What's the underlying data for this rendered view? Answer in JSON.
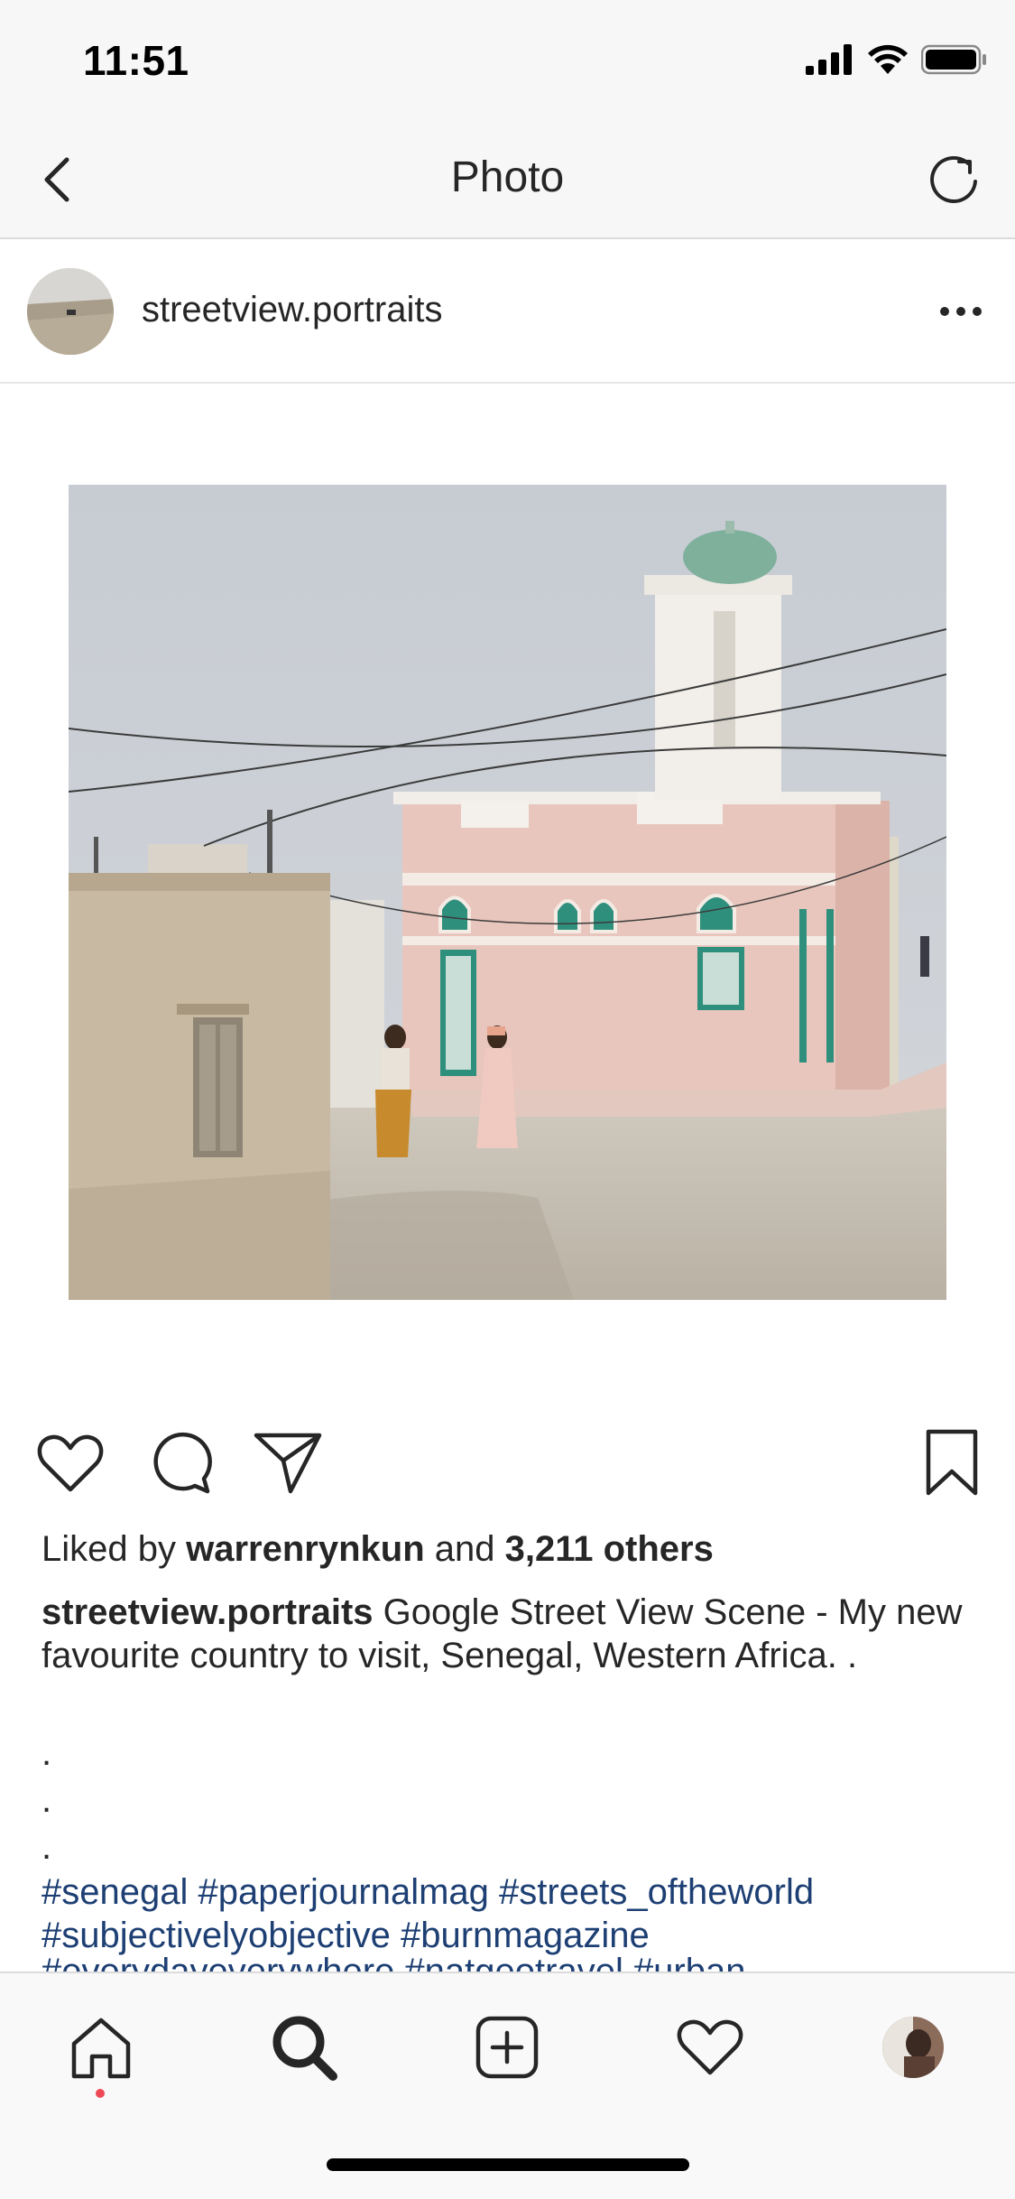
{
  "status_bar": {
    "time": "11:51"
  },
  "nav": {
    "title": "Photo",
    "back_icon": "chevron-left-icon",
    "refresh_icon": "refresh-icon"
  },
  "post": {
    "username": "streetview.portraits",
    "more_icon": "more-horizontal-icon",
    "image_description_icon": "mosque-street-photo"
  },
  "actions": {
    "like_icon": "heart-icon",
    "comment_icon": "comment-icon",
    "share_icon": "send-icon",
    "save_icon": "bookmark-icon"
  },
  "likes": {
    "prefix": "Liked by ",
    "user": "warrenrynkun",
    "middle": " and ",
    "count": "3,211 others"
  },
  "caption": {
    "username": "streetview.portraits",
    "text": " Google Street View Scene - My new favourite country to visit, Senegal, Western Africa. .",
    "dots": [
      ".",
      ".",
      "."
    ]
  },
  "hashtags": {
    "line1": "#senegal #paperjournalmag  #streets_oftheworld",
    "line2": "#subjectivelyobjective #burnmagazine",
    "line3": "#everydayeverywhere #natgeotravel #urban"
  },
  "tab_bar": {
    "items": [
      "home-icon",
      "search-icon",
      "add-post-icon",
      "activity-heart-icon",
      "profile-avatar"
    ],
    "notification_color": "#ed4956"
  },
  "colors": {
    "hashtag": "#1d3f73",
    "bars": "#f7f7f7",
    "text": "#262626"
  }
}
